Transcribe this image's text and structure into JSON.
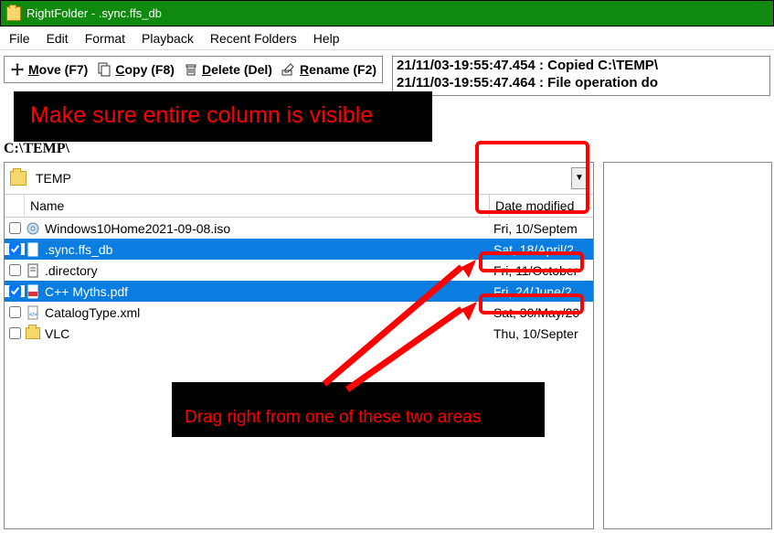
{
  "window": {
    "app": "RightFolder",
    "file": ".sync.ffs_db"
  },
  "menu": [
    "File",
    "Edit",
    "Format",
    "Playback",
    "Recent Folders",
    "Help"
  ],
  "toolbar": {
    "move": "Move (F7)",
    "copy": "Copy (F8)",
    "delete": "Delete (Del)",
    "rename": "Rename (F2)"
  },
  "log": [
    "21/11/03-19:55:47.454 : Copied C:\\TEMP\\",
    "21/11/03-19:55:47.464 : File operation do"
  ],
  "annotations": {
    "top": "Make sure entire column is visible",
    "bottom": "Drag right from one of these two areas"
  },
  "breadcrumb": "C:\\TEMP\\",
  "path": {
    "label": "TEMP"
  },
  "columns": {
    "name": "Name",
    "date": "Date modified"
  },
  "rows": [
    {
      "checked": false,
      "icon": "disc",
      "name": "Windows10Home2021-09-08.iso",
      "date": "Fri, 10/Septem",
      "selected": false
    },
    {
      "checked": true,
      "icon": "file",
      "name": ".sync.ffs_db",
      "date": "Sat, 18/April/2",
      "selected": true
    },
    {
      "checked": false,
      "icon": "file",
      "name": ".directory",
      "date": "Fri, 11/October",
      "selected": false
    },
    {
      "checked": true,
      "icon": "pdf",
      "name": "C++ Myths.pdf",
      "date": "Fri, 24/June/2",
      "selected": true
    },
    {
      "checked": false,
      "icon": "xml",
      "name": "CatalogType.xml",
      "date": "Sat, 30/May/20",
      "selected": false
    },
    {
      "checked": false,
      "icon": "folder",
      "name": "VLC",
      "date": "Thu, 10/Septer",
      "selected": false
    }
  ]
}
